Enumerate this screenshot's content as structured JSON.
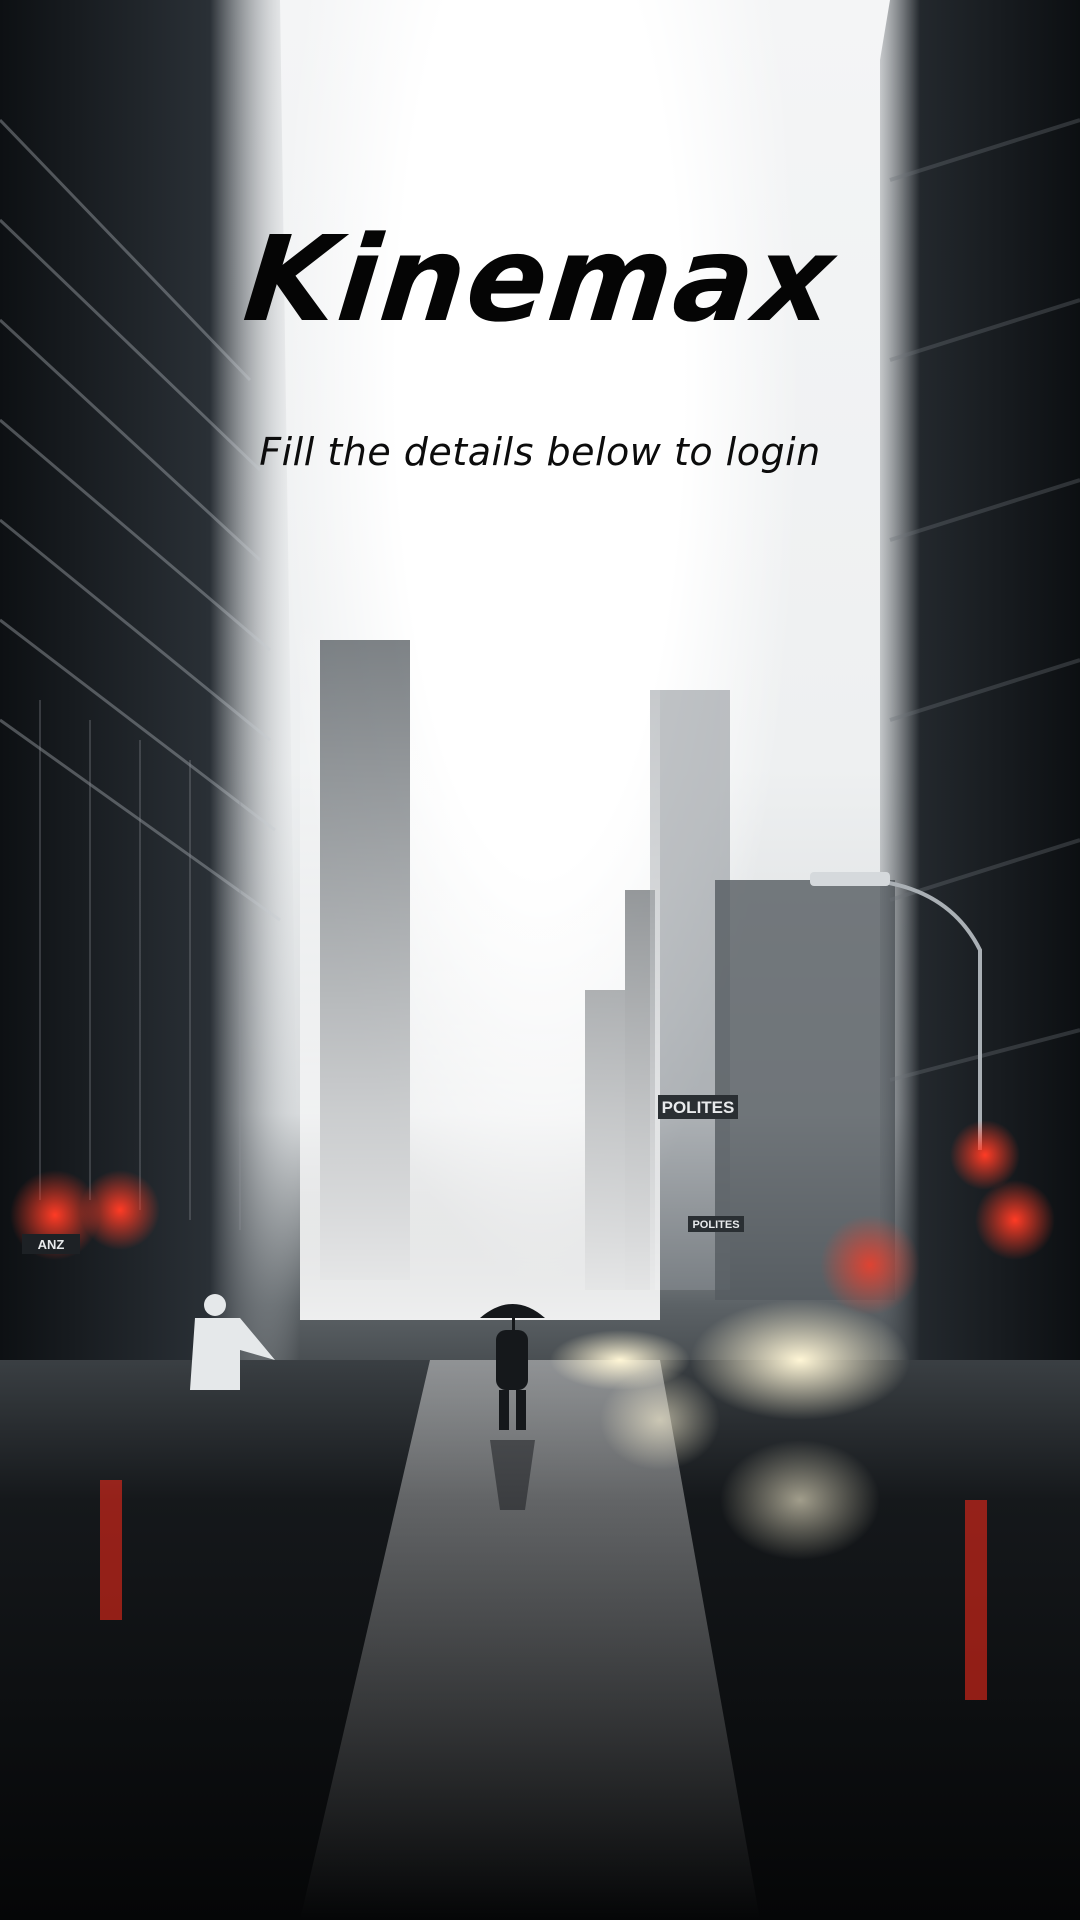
{
  "app": {
    "title": "Kinemax",
    "subtitle": "Fill the details below to login"
  },
  "background": {
    "signs": [
      "POLITES",
      "POLITES",
      "ANZ"
    ],
    "colors": {
      "sky": "#ffffff",
      "buildings": "#1b1f23",
      "street": "#0b0c0e",
      "signal_red": "#ff2a1a",
      "headlight": "#fff3c8"
    }
  }
}
